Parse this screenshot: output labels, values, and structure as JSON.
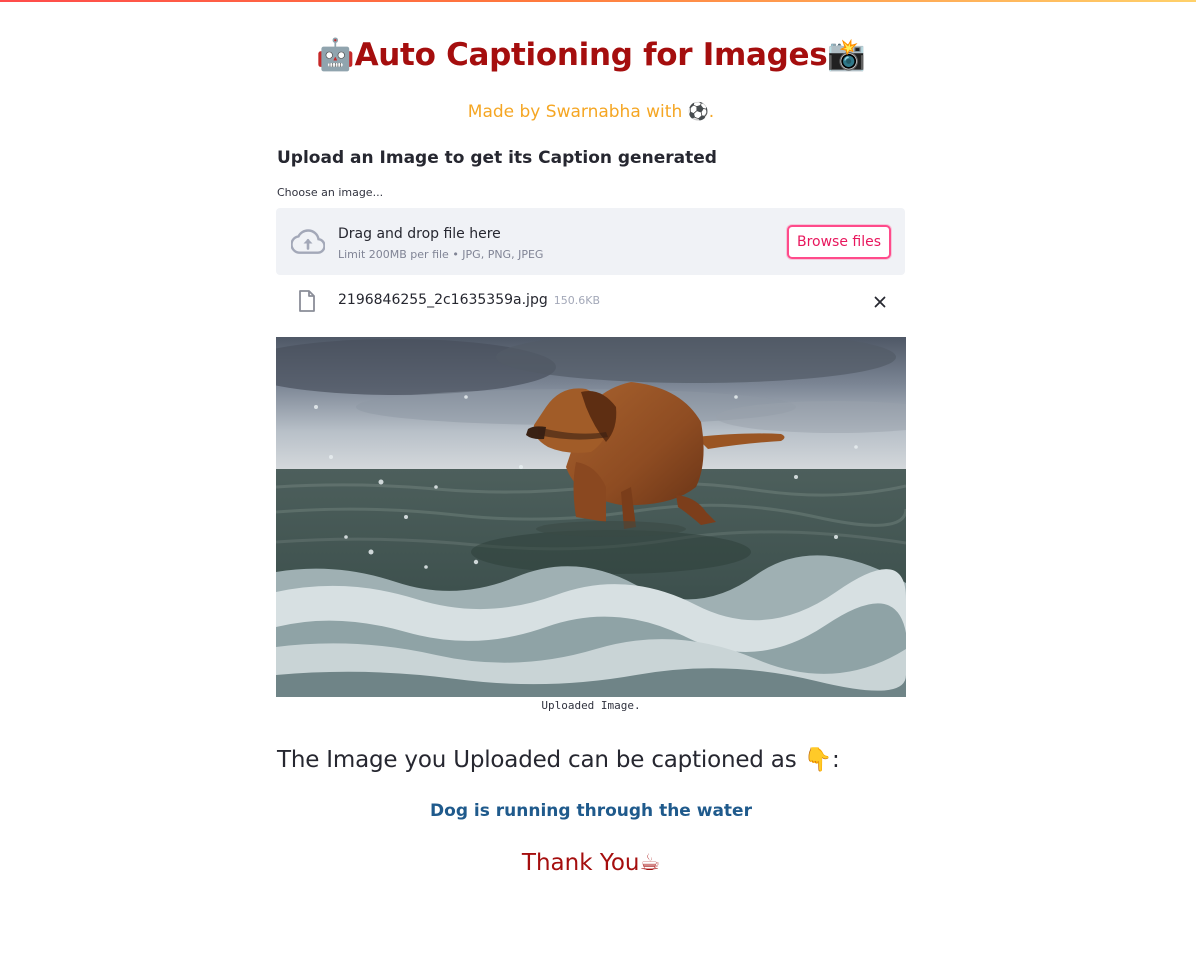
{
  "header": {
    "title_icon_left": "🤖",
    "title": "Auto Captioning for Images",
    "title_icon_right": "📸",
    "subtitle": "Made by Swarnabha with ⚽."
  },
  "upload": {
    "section_title": "Upload an Image to get its Caption generated",
    "label": "Choose an image...",
    "dropzone_text": "Drag and drop file here",
    "limit_text": "Limit 200MB per file • JPG, PNG, JPEG",
    "browse_label": "Browse files",
    "icon": "cloud-upload-icon"
  },
  "file": {
    "name": "2196846255_2c1635359a.jpg",
    "size": "150.6KB",
    "icon": "file-icon",
    "remove_icon": "close-icon"
  },
  "image": {
    "caption": "Uploaded Image."
  },
  "result": {
    "heading": "The Image you Uploaded can be captioned as 👇:",
    "caption": "Dog is running through the water",
    "thanks": "Thank You☕"
  },
  "colors": {
    "title": "#a50e0e",
    "subtitle": "#f5a623",
    "accent_button": "#ff4b8b",
    "caption": "#1f5a8c",
    "dropzone_bg": "#f0f2f6"
  }
}
